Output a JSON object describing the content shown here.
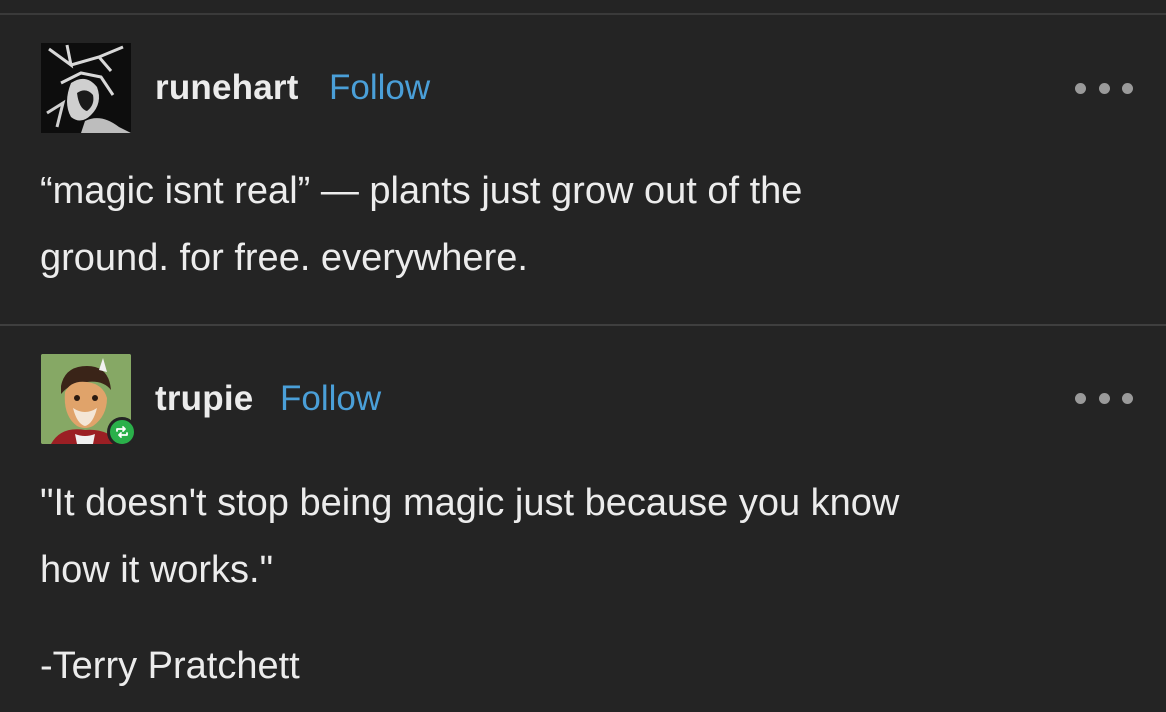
{
  "posts": [
    {
      "username": "runehart",
      "follow_label": "Follow",
      "text": "“magic isnt real” — plants just grow out of the\nground. for free. everywhere.",
      "icons": {
        "avatar": "runehart-avatar",
        "more": "more-options-icon"
      }
    },
    {
      "username": "trupie",
      "follow_label": "Follow",
      "text": "\"It doesn't stop being magic just because you know\nhow it works.\"",
      "attribution": "-Terry Pratchett",
      "icons": {
        "avatar": "trupie-avatar",
        "badge": "reblog-icon",
        "more": "more-options-icon"
      }
    }
  ],
  "colors": {
    "background": "#242424",
    "follow": "#4a9fd8",
    "text": "#ececec",
    "reblog_badge": "#2ab04a"
  }
}
